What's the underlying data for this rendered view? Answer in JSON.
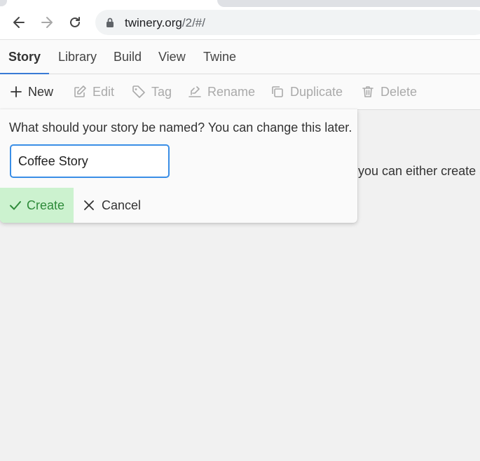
{
  "browser": {
    "url_host": "twinery.org",
    "url_path": "/2/#/"
  },
  "top_menu": {
    "tabs": [
      {
        "label": "Story",
        "active": true
      },
      {
        "label": "Library",
        "active": false
      },
      {
        "label": "Build",
        "active": false
      },
      {
        "label": "View",
        "active": false
      },
      {
        "label": "Twine",
        "active": false
      }
    ]
  },
  "toolbar": {
    "new_label": "New",
    "edit_label": "Edit",
    "tag_label": "Tag",
    "rename_label": "Rename",
    "duplicate_label": "Duplicate",
    "delete_label": "Delete"
  },
  "content": {
    "partial_text": "you can either create a"
  },
  "dialog": {
    "prompt": "What should your story be named? You can change this later.",
    "name_value": "Coffee Story",
    "create_label": "Create",
    "cancel_label": "Cancel"
  },
  "colors": {
    "accent": "#3a7bd5",
    "create_bg": "#ccf2cf",
    "create_text": "#2e8b3a"
  }
}
